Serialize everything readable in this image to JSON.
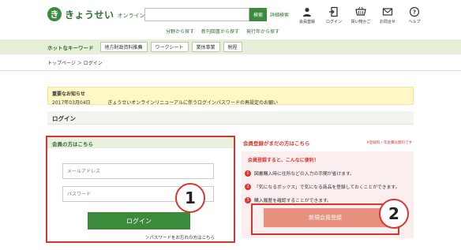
{
  "header": {
    "logo_mark": "き",
    "logo_text": "きょうせい",
    "logo_sub": "オンライン",
    "search_placeholder": "",
    "search_button": "検索",
    "detail_search": "詳細検索",
    "search_links": [
      "分野から探す",
      "新刊図書から探す",
      "発行年から探す"
    ],
    "icons": [
      {
        "label": "会員登録",
        "icon": "user-icon"
      },
      {
        "label": "ログイン",
        "icon": "login-door-icon"
      },
      {
        "label": "買い物かご",
        "icon": "cart-icon"
      },
      {
        "label": "お問合せ",
        "icon": "mail-icon"
      },
      {
        "label": "ヘルプ",
        "icon": "help-icon"
      }
    ]
  },
  "keyword_bar": {
    "label": "ホットなキーワード",
    "tags": [
      "地方財政資料推薦",
      "ワークシート",
      "業体事業",
      "税程"
    ]
  },
  "breadcrumb": "トップページ ＞ ログイン",
  "notice": {
    "title": "重要なお知らせ",
    "date": "2017年03月04日",
    "text": "ぎょうせいオンラインリニューアルに伴うログインパスワードの再設定のお願い"
  },
  "login_heading": "ログイン",
  "login": {
    "header": "会員の方はこちら",
    "email_placeholder": "メールアドレス",
    "password_placeholder": "パスワード",
    "button": "ログイン",
    "forgot": "＞パスワードをお忘れの方はこちら"
  },
  "register": {
    "title": "会員登録がまだの方はこちら",
    "note": "※登録料・年会費は無料です",
    "benefit_title": "会員登録すると、こんなに便利！",
    "benefits": [
      {
        "num": "1",
        "text": "図書購入時に住所などの入力の手間が省けます。"
      },
      {
        "num": "2",
        "text": "「気になるボックス」で気になる商品を登録しておくことができます。"
      },
      {
        "num": "3",
        "text": "購入履歴を確認することができます。"
      }
    ],
    "button": "新規会員登録"
  },
  "callouts": [
    "1",
    "2"
  ],
  "colors": {
    "brand_green": "#3c8a3c",
    "accent_red": "#d9362e",
    "notice_yellow": "#fff8c4",
    "register_pink": "#fbeeee"
  }
}
